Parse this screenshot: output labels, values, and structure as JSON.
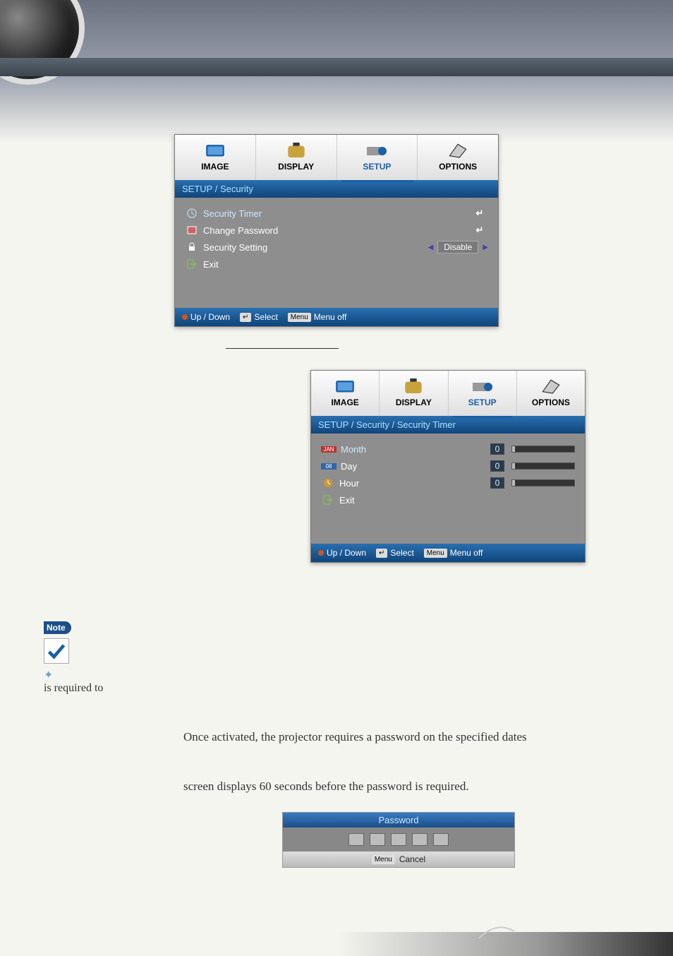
{
  "tabs": {
    "image": "IMAGE",
    "display": "DISPLAY",
    "setup": "SETUP",
    "options": "OPTIONS"
  },
  "osd1": {
    "breadcrumb": "SETUP / Security",
    "rows": {
      "security_timer": "Security Timer",
      "change_password": "Change Password",
      "security_setting": "Security Setting",
      "security_setting_value": "Disable",
      "exit": "Exit"
    }
  },
  "osd2": {
    "breadcrumb": "SETUP / Security / Security Timer",
    "rows": {
      "month": "Month",
      "month_val": "0",
      "day": "Day",
      "day_val": "0",
      "hour": "Hour",
      "hour_val": "0",
      "exit": "Exit",
      "month_badge": "JAN",
      "day_badge": "08"
    }
  },
  "footer": {
    "updown": "Up / Down",
    "select": "Select",
    "menuoff": "Menu off",
    "key_enter": "↵",
    "key_menu": "Menu"
  },
  "note": {
    "badge": "Note",
    "line": "is required to"
  },
  "body": {
    "line1": "Once activated, the projector requires a password on the specified dates",
    "line2": "screen displays 60 seconds before the password is required."
  },
  "password": {
    "title": "Password",
    "cancel": "Cancel",
    "key_menu": "Menu"
  }
}
